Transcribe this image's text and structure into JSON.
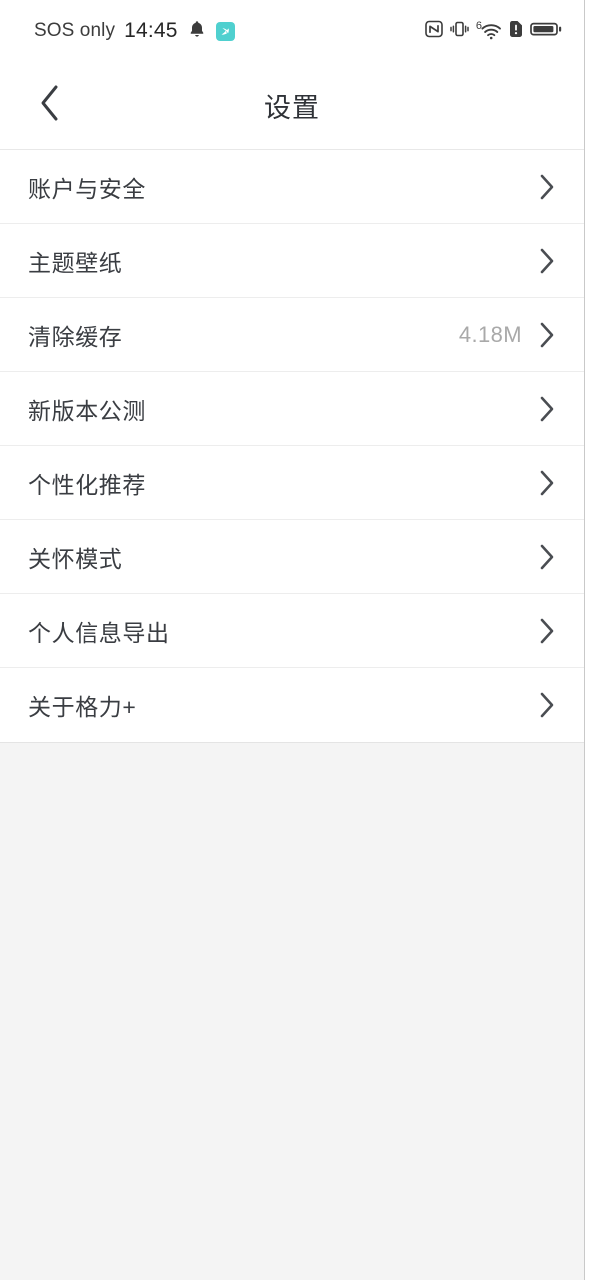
{
  "status_bar": {
    "carrier": "SOS only",
    "clock": "14:45",
    "icons_left": [
      "bell-icon",
      "app-badge-icon"
    ],
    "icons_right": [
      "nfc-icon",
      "vibrate-icon",
      "wifi-6-icon",
      "sim-alert-icon",
      "battery-icon"
    ],
    "wifi_generation": "6",
    "app_badge_color": "#4fd0cf"
  },
  "header": {
    "title": "设置",
    "back_icon": "chevron-left-icon"
  },
  "list": {
    "rows": [
      {
        "label": "账户与安全",
        "value": "",
        "chevron": "chevron-right-icon"
      },
      {
        "label": "主题壁纸",
        "value": "",
        "chevron": "chevron-right-icon"
      },
      {
        "label": "清除缓存",
        "value": "4.18M",
        "chevron": "chevron-right-icon"
      },
      {
        "label": "新版本公测",
        "value": "",
        "chevron": "chevron-right-icon"
      },
      {
        "label": "个性化推荐",
        "value": "",
        "chevron": "chevron-right-icon"
      },
      {
        "label": "关怀模式",
        "value": "",
        "chevron": "chevron-right-icon"
      },
      {
        "label": "个人信息导出",
        "value": "",
        "chevron": "chevron-right-icon"
      },
      {
        "label": "关于格力+",
        "value": "",
        "chevron": "chevron-right-icon"
      }
    ]
  },
  "colors": {
    "page_background": "#f4f4f4",
    "list_background": "#ffffff",
    "primary_text": "#3a3d42",
    "secondary_text": "#a9a9a9",
    "divider": "#ededed"
  }
}
